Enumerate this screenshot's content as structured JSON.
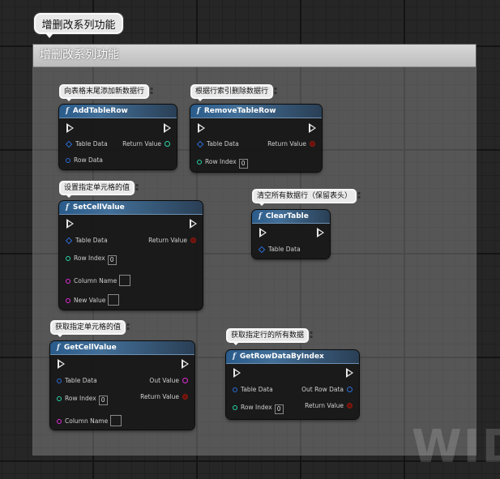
{
  "group_title": "增删改系列功能",
  "comment_header": "增删改系列功能",
  "watermark": "WIDG",
  "comments": {
    "add_row": "向表格末尾添加新数据行",
    "remove_row": "根据行索引删除数据行",
    "set_cell": "设置指定单元格的值",
    "clear_table": "清空所有数据行（保留表头）",
    "get_cell": "获取指定单元格的值",
    "get_row": "获取指定行的所有数据"
  },
  "nodes": {
    "add_table_row": {
      "title": "AddTableRow",
      "pins": {
        "table_data": "Table Data",
        "return_value": "Return Value",
        "row_data": "Row Data"
      }
    },
    "remove_table_row": {
      "title": "RemoveTableRow",
      "pins": {
        "table_data": "Table Data",
        "return_value": "Return Value",
        "row_index": "Row Index",
        "row_index_value": "0"
      }
    },
    "set_cell_value": {
      "title": "SetCellValue",
      "pins": {
        "table_data": "Table Data",
        "return_value": "Return Value",
        "row_index": "Row Index",
        "row_index_value": "0",
        "column_name": "Column Name",
        "new_value": "New Value"
      }
    },
    "clear_table": {
      "title": "ClearTable",
      "pins": {
        "table_data": "Table Data"
      }
    },
    "get_cell_value": {
      "title": "GetCellValue",
      "pins": {
        "table_data": "Table Data",
        "out_value": "Out Value",
        "row_index": "Row Index",
        "row_index_value": "0",
        "return_value": "Return Value",
        "column_name": "Column Name"
      }
    },
    "get_row_data_by_index": {
      "title": "GetRowDataByIndex",
      "pins": {
        "table_data": "Table Data",
        "out_row_data": "Out Row Data",
        "row_index": "Row Index",
        "row_index_value": "0",
        "return_value": "Return Value"
      }
    }
  },
  "icons": {
    "function": "function-icon",
    "exec": "exec-pin-icon",
    "pin_toggle": "comment-pin-icon"
  },
  "colors": {
    "header_blue": "#2a5b8a",
    "exec": "#e8e8e8",
    "struct_blue": "#2a6dd8",
    "int_teal": "#28d7a7",
    "name_magenta": "#e02bd6",
    "bool_red": "#8a1c12"
  }
}
